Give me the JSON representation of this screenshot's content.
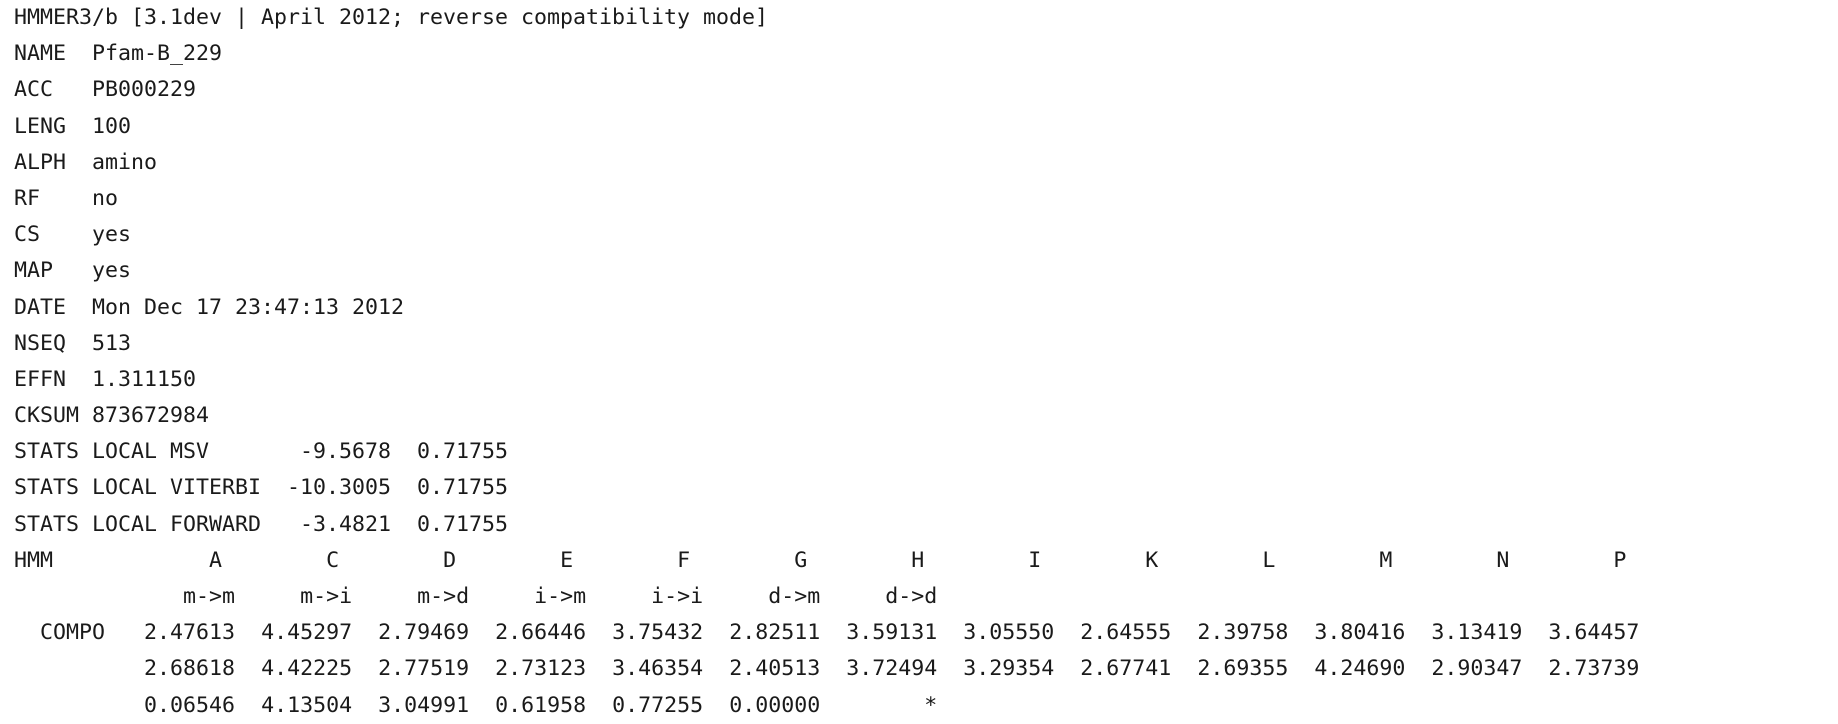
{
  "header": "HMMER3/b [3.1dev | April 2012; reverse compatibility mode]",
  "fields": [
    {
      "key": "NAME ",
      "value": "Pfam-B_229"
    },
    {
      "key": "ACC  ",
      "value": "PB000229"
    },
    {
      "key": "LENG ",
      "value": "100"
    },
    {
      "key": "ALPH ",
      "value": "amino"
    },
    {
      "key": "RF   ",
      "value": "no"
    },
    {
      "key": "CS   ",
      "value": "yes"
    },
    {
      "key": "MAP  ",
      "value": "yes"
    },
    {
      "key": "DATE ",
      "value": "Mon Dec 17 23:47:13 2012"
    },
    {
      "key": "NSEQ ",
      "value": "513"
    },
    {
      "key": "EFFN ",
      "value": "1.311150"
    },
    {
      "key": "CKSUM",
      "value": "873672984"
    }
  ],
  "stats": [
    {
      "prefix": "STATS LOCAL MSV    ",
      "mu": "   -9.5678",
      "lambda": "  0.71755"
    },
    {
      "prefix": "STATS LOCAL VITERBI",
      "mu": "  -10.3005",
      "lambda": "  0.71755"
    },
    {
      "prefix": "STATS LOCAL FORWARD",
      "mu": "   -3.4821",
      "lambda": "  0.71755"
    }
  ],
  "hmm": {
    "label": "HMM     ",
    "alphabet": [
      "A",
      "C",
      "D",
      "E",
      "F",
      "G",
      "H",
      "I",
      "K",
      "L",
      "M",
      "N",
      "P"
    ],
    "transitions_indent": "         ",
    "transitions": [
      "m->m",
      "m->i",
      "m->d",
      "i->m",
      "i->i",
      "d->m",
      "d->d"
    ]
  },
  "compo": {
    "label": "  COMPO ",
    "match_emissions": [
      "2.47613",
      "4.45297",
      "2.79469",
      "2.66446",
      "3.75432",
      "2.82511",
      "3.59131",
      "3.05550",
      "2.64555",
      "2.39758",
      "3.80416",
      "3.13419",
      "3.64457"
    ],
    "insert_emissions": [
      "2.68618",
      "4.42225",
      "2.77519",
      "2.73123",
      "3.46354",
      "2.40513",
      "3.72494",
      "3.29354",
      "2.67741",
      "2.69355",
      "4.24690",
      "2.90347",
      "2.73739"
    ],
    "transitions": [
      "0.06546",
      "4.13504",
      "3.04991",
      "0.61958",
      "0.77255",
      "0.00000",
      "*"
    ]
  }
}
